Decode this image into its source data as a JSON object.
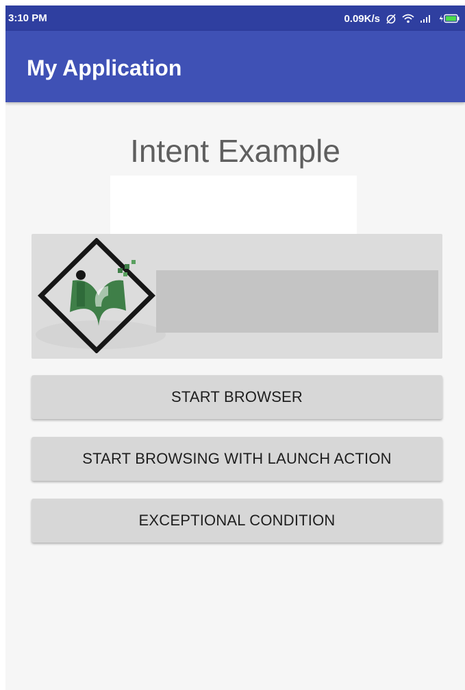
{
  "status_bar": {
    "time": "3:10 PM",
    "network_speed": "0.09K/s",
    "icons": [
      "alarm-icon",
      "wifi-icon",
      "signal-icon",
      "battery-icon"
    ]
  },
  "app_bar": {
    "title": "My Application"
  },
  "main": {
    "heading": "Intent Example",
    "logo_icon": "tutorials-logo-icon",
    "buttons": [
      {
        "label": "START BROWSER"
      },
      {
        "label": "START BROWSING WITH LAUNCH ACTION"
      },
      {
        "label": "EXCEPTIONAL CONDITION"
      }
    ]
  },
  "colors": {
    "app_bar": "#3f51b5",
    "status_bar": "#2f3fa0",
    "button_bg": "#d7d7d7",
    "panel_bg": "#dcdcdc",
    "accent_green": "#79d43a",
    "logo_green": "#3f7f48"
  }
}
